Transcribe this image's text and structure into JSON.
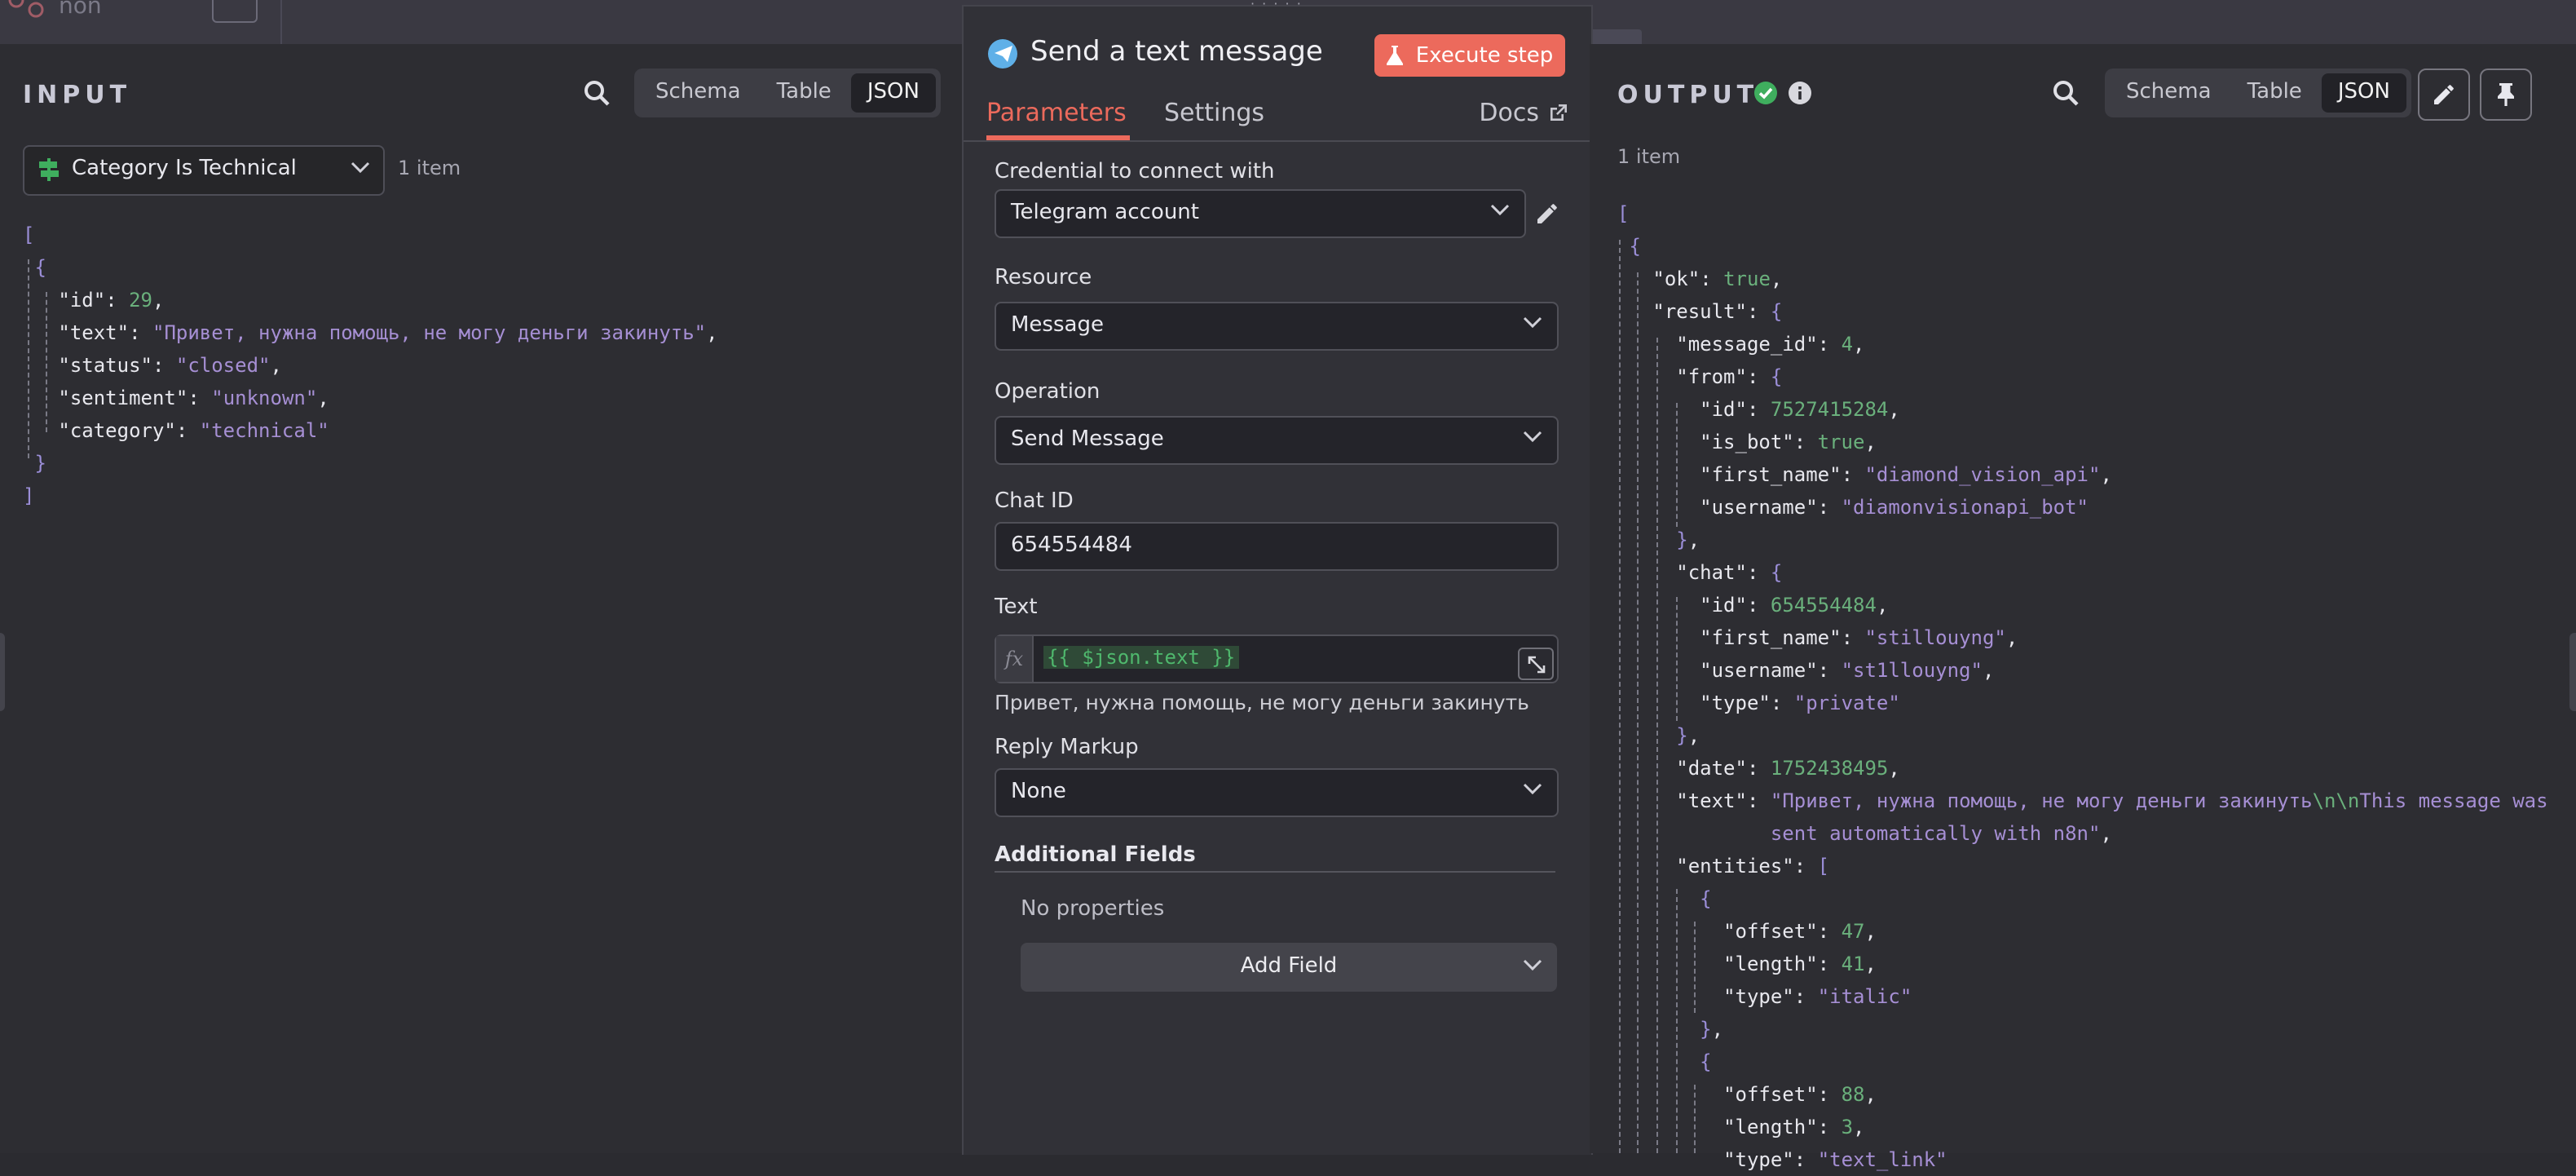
{
  "background": {
    "node_label": "non"
  },
  "input": {
    "title": "INPUT",
    "view_tabs": [
      "Schema",
      "Table",
      "JSON"
    ],
    "active_tab": "JSON",
    "source_node": "Category Is Technical",
    "items_count": "1 item",
    "json": {
      "id": "29",
      "text": "\"Привет, нужна помощь, не могу деньги закинуть\"",
      "status": "\"closed\"",
      "sentiment": "\"unknown\"",
      "category": "\"technical\""
    }
  },
  "modal": {
    "title": "Send a text message",
    "execute_label": "Execute step",
    "tabs": {
      "parameters": "Parameters",
      "settings": "Settings",
      "docs": "Docs"
    },
    "credential": {
      "label": "Credential to connect with",
      "value": "Telegram account"
    },
    "resource": {
      "label": "Resource",
      "value": "Message"
    },
    "operation": {
      "label": "Operation",
      "value": "Send Message"
    },
    "chat_id": {
      "label": "Chat ID",
      "value": "654554484"
    },
    "text": {
      "label": "Text",
      "fx": "fx",
      "expression": "{{ $json.text }}",
      "preview": "Привет, нужна помощь, не могу деньги закинуть"
    },
    "reply_markup": {
      "label": "Reply Markup",
      "value": "None"
    },
    "additional_fields": {
      "label": "Additional Fields",
      "empty": "No properties",
      "add_label": "Add Field"
    }
  },
  "output": {
    "title": "OUTPUT",
    "view_tabs": [
      "Schema",
      "Table",
      "JSON"
    ],
    "active_tab": "JSON",
    "items_count": "1 item",
    "json": {
      "ok": "true",
      "message_id": "4",
      "from_id": "7527415284",
      "from_is_bot": "true",
      "from_first_name": "\"diamond_vision_api\"",
      "from_username": "\"diamonvisionapi_bot\"",
      "chat_id": "654554484",
      "chat_first_name": "\"stillouyng\"",
      "chat_username": "\"st1llouyng\"",
      "chat_type": "\"private\"",
      "date": "1752438495",
      "text_line1_a": "\"Привет, нужна помощь, не могу деньги закинуть",
      "text_line1_esc": "\\n\\n",
      "text_line1_b": "This message was",
      "text_line2": "sent automatically with n8n\"",
      "e0_offset": "47",
      "e0_length": "41",
      "e0_type": "\"italic\"",
      "e1_offset": "88",
      "e1_length": "3",
      "e1_type": "\"text_link\""
    }
  },
  "colors": {
    "accent": "#ec6a5c",
    "success": "#3fae5e",
    "telegram": "#5fb0e8",
    "string": "#a68fd4",
    "number": "#6ab07c"
  }
}
